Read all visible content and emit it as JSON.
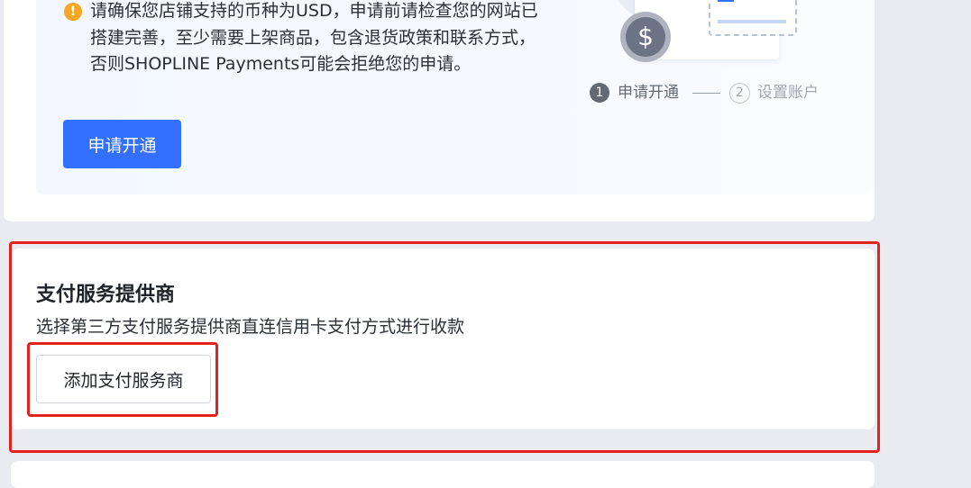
{
  "top_card": {
    "notice": "请确保您店铺支持的币种为USD，申请前请检查您的网站已搭建完善，至少需要上架商品，包含退货政策和联系方式，否则SHOPLINE Payments可能会拒绝您的申请。",
    "apply_button": "申请开通",
    "currency_symbol": "$",
    "steps": [
      {
        "number": "1",
        "label": "申请开通"
      },
      {
        "number": "2",
        "label": "设置账户"
      }
    ]
  },
  "payment_providers": {
    "title": "支付服务提供商",
    "description": "选择第三方支付服务提供商直连信用卡支付方式进行收款",
    "add_button": "添加支付服务商"
  },
  "icons": {
    "warning": "warning-icon",
    "coin": "dollar-coin-icon"
  },
  "colors": {
    "primary": "#3370ff",
    "warning": "#f5a623",
    "highlight": "#e3221d"
  }
}
